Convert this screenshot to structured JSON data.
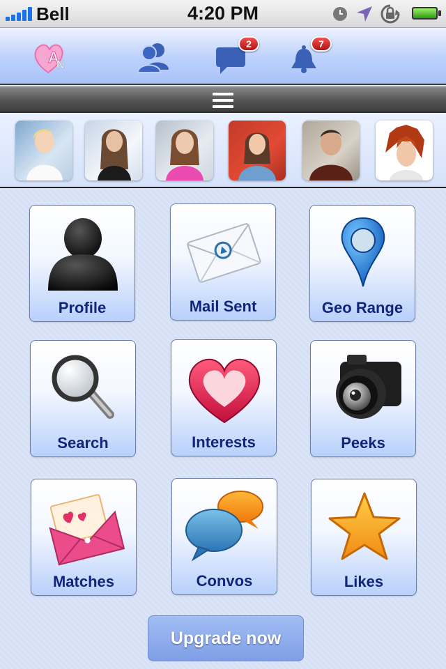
{
  "status_bar": {
    "carrier": "Bell",
    "time": "4:20 PM",
    "signal_bars": 5,
    "battery_icon": "battery-full-icon",
    "icons": [
      "clock-icon",
      "location-arrow-icon",
      "rotation-lock-icon",
      "battery-icon"
    ]
  },
  "nav": {
    "logo_icon": "app-logo-icon",
    "friends_icon": "people-icon",
    "messages_icon": "chat-bubble-icon",
    "messages_badge": "2",
    "notifications_icon": "bell-icon",
    "notifications_badge": "7"
  },
  "menu": {
    "icon": "hamburger-menu-icon"
  },
  "photos": [
    "profile-photo-1",
    "profile-photo-2",
    "profile-photo-3",
    "profile-photo-4",
    "profile-photo-5",
    "profile-photo-6"
  ],
  "tiles": [
    {
      "label": "Profile",
      "icon": "person-silhouette-icon"
    },
    {
      "label": "Mail Sent",
      "icon": "envelope-icon"
    },
    {
      "label": "Geo Range",
      "icon": "map-pin-icon"
    },
    {
      "label": "Search",
      "icon": "magnifying-glass-icon"
    },
    {
      "label": "Interests",
      "icon": "heart-icon"
    },
    {
      "label": "Peeks",
      "icon": "camera-icon"
    },
    {
      "label": "Matches",
      "icon": "love-letter-icon"
    },
    {
      "label": "Convos",
      "icon": "speech-bubbles-icon"
    },
    {
      "label": "Likes",
      "icon": "star-icon"
    }
  ],
  "upgrade": {
    "label": "Upgrade now"
  },
  "colors": {
    "accent": "#2f5fbf",
    "badge": "#d42a2a",
    "tile_label": "#13257a",
    "upgrade_bg": "#8fabec"
  }
}
